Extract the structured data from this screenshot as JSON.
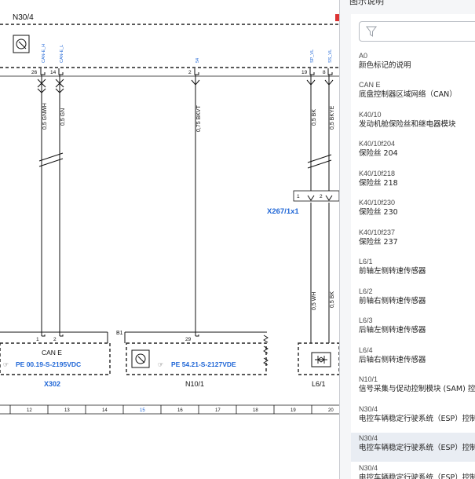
{
  "diagram": {
    "top_label": "N30/4",
    "connector_x267": "X267/1x1",
    "b1_label": "B1",
    "can_label": "CAN E",
    "ref_left": "PE 00.19-S-2195VDC",
    "ref_mid": "PE 54.21-S-2127VDE",
    "comp_x302": "X302",
    "comp_n10": "N10/1",
    "comp_l6": "L6/1",
    "top_signals": [
      "CAN-E_H",
      "CAN-E_L",
      "54",
      "SP_VL",
      "SS_VL"
    ],
    "top_pins": [
      "26",
      "14",
      "2",
      "19",
      "8"
    ],
    "wires": [
      "0,5 GNWH",
      "0,5 GN",
      "0,75 BKVT",
      "0,5 BK",
      "0,5 BKYE"
    ],
    "lower_wires": [
      "0,5 WH",
      "0,5 BK"
    ],
    "x267_pins": [
      "1",
      "2"
    ],
    "x302_pins": [
      "1",
      "2"
    ],
    "n10_pin": "29",
    "grid_numbers": [
      "12",
      "13",
      "14",
      "15",
      "16",
      "17",
      "18",
      "19",
      "20"
    ],
    "grid_highlight": "15",
    "colors": {
      "line": "#111111",
      "accent": "#1f66d6",
      "dash": "#222222",
      "highlight": "#1f66d6"
    }
  },
  "panel": {
    "title": "图示说明",
    "filter_placeholder": "",
    "filter_icon": "funnel-icon",
    "items": [
      {
        "code": "A0",
        "desc": "颜色标记的说明"
      },
      {
        "code": "CAN E",
        "desc": "底盘控制器区域网络（CAN）"
      },
      {
        "code": "K40/10",
        "desc": "发动机舱保险丝和继电器模块"
      },
      {
        "code": "K40/10f204",
        "desc": "保险丝 204"
      },
      {
        "code": "K40/10f218",
        "desc": "保险丝 218"
      },
      {
        "code": "K40/10f230",
        "desc": "保险丝 230"
      },
      {
        "code": "K40/10f237",
        "desc": "保险丝 237"
      },
      {
        "code": "L6/1",
        "desc": "前轴左侧转速传感器"
      },
      {
        "code": "L6/2",
        "desc": "前轴右侧转速传感器"
      },
      {
        "code": "L6/3",
        "desc": "后轴左侧转速传感器"
      },
      {
        "code": "L6/4",
        "desc": "后轴右侧转速传感器"
      },
      {
        "code": "N10/1",
        "desc": "信号采集与促动控制模块 (SAM) 控制单元"
      },
      {
        "code": "N30/4",
        "desc": "电控车辆稳定行驶系统（ESP）控制单元"
      },
      {
        "code": "N30/4",
        "desc": "电控车辆稳定行驶系统（ESP）控制单元"
      },
      {
        "code": "N30/4",
        "desc": "电控车辆稳定行驶系统（ESP）控制单元"
      }
    ],
    "selected_index": 13
  }
}
